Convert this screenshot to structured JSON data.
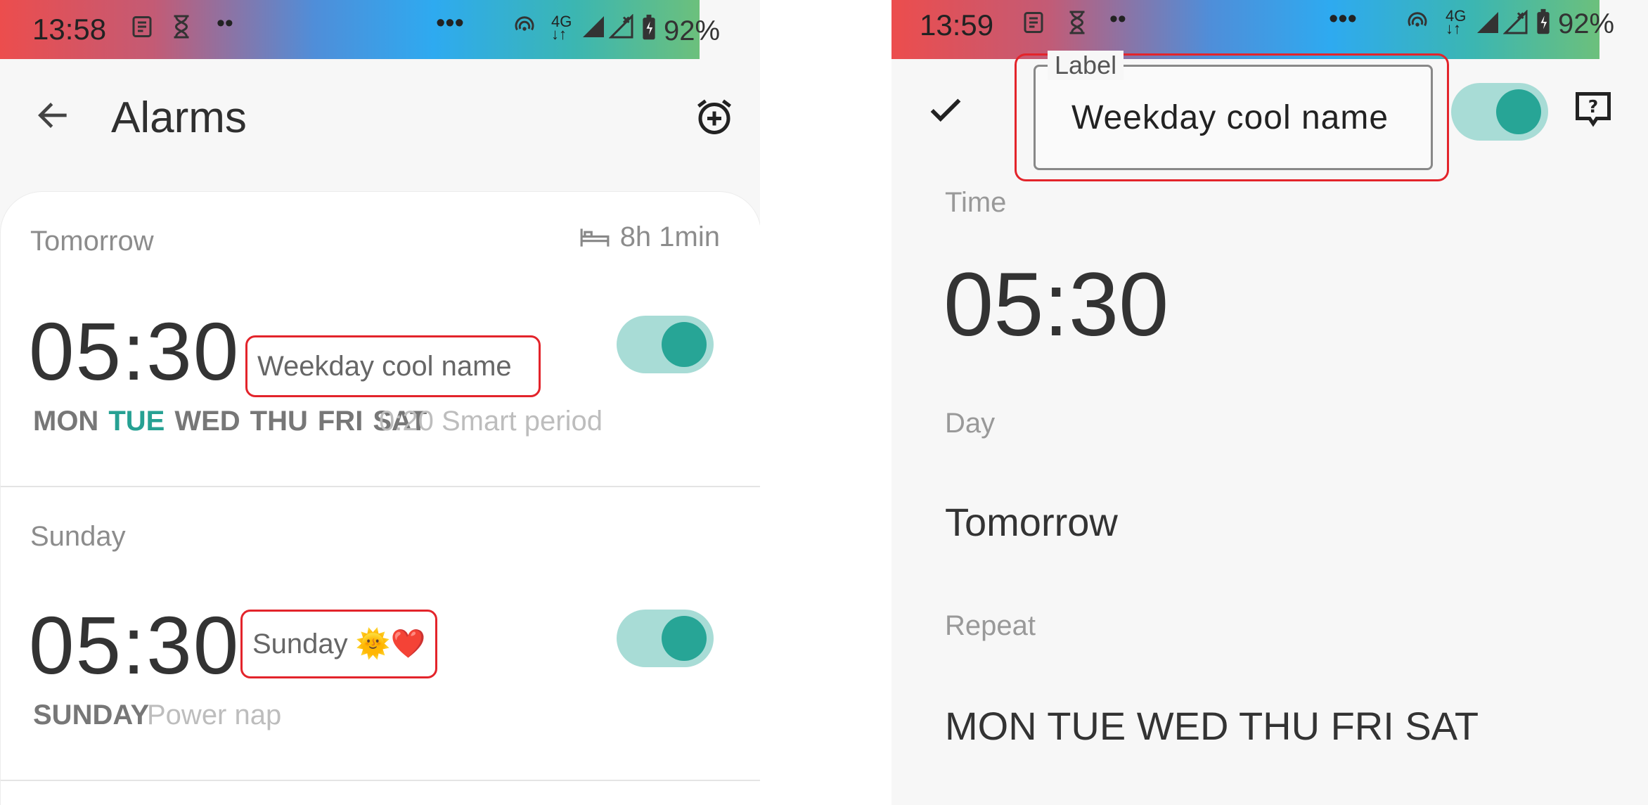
{
  "left": {
    "status": {
      "time": "13:58",
      "battery": "92%"
    },
    "title": "Alarms",
    "alarms": [
      {
        "day": "Tomorrow",
        "sleep": "8h 1min",
        "time": "05:30",
        "label": "Weekday cool name",
        "days": [
          "MON",
          "TUE",
          "WED",
          "THU",
          "FRI",
          "SAT"
        ],
        "active_day": "TUE",
        "extra": "0:20 Smart period",
        "enabled": true
      },
      {
        "day": "Sunday",
        "time": "05:30",
        "label": "Sunday 🌞❤️",
        "days_text": "SUNDAY",
        "extra": "Power nap",
        "enabled": true
      }
    ]
  },
  "right": {
    "status": {
      "time": "13:59",
      "battery": "92%"
    },
    "label_field": {
      "legend": "Label",
      "value": "Weekday cool name"
    },
    "enabled": true,
    "sections": {
      "time_label": "Time",
      "time_value": "05:30",
      "day_label": "Day",
      "day_value": "Tomorrow",
      "repeat_label": "Repeat",
      "repeat_value": "MON TUE WED THU FRI SAT"
    }
  },
  "colors": {
    "accent": "#27a596",
    "accent_track": "#a8dcd6",
    "highlight_box": "#e3242b"
  },
  "icons": [
    "back-arrow-icon",
    "add-alarm-icon",
    "bed-icon",
    "check-icon",
    "help-feedback-icon",
    "news-icon",
    "hourglass-icon",
    "hotspot-icon",
    "signal-icon",
    "battery-icon"
  ]
}
